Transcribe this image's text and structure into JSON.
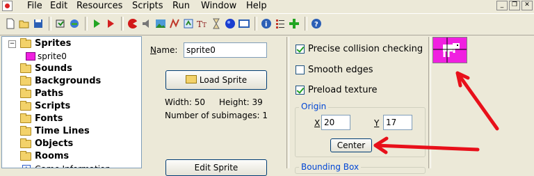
{
  "menubar": {
    "items": [
      "File",
      "Edit",
      "Resources",
      "Scripts",
      "Run",
      "Window",
      "Help"
    ]
  },
  "toolbar": {
    "icons": [
      "new-icon",
      "open-icon",
      "save-icon",
      "create-executable-icon",
      "publish-icon",
      "run-icon",
      "run-debug-icon",
      "add-sprite-icon",
      "add-sound-icon",
      "add-background-icon",
      "add-path-icon",
      "add-script-icon",
      "add-font-icon",
      "add-timeline-icon",
      "add-object-icon",
      "add-room-icon",
      "game-info-icon",
      "global-settings-icon",
      "extension-packages-icon",
      "help-icon"
    ]
  },
  "tree": {
    "items": [
      {
        "label": "Sprites",
        "expanded": true
      },
      {
        "label": "sprite0",
        "child": true
      },
      {
        "label": "Sounds"
      },
      {
        "label": "Backgrounds"
      },
      {
        "label": "Paths"
      },
      {
        "label": "Scripts"
      },
      {
        "label": "Fonts"
      },
      {
        "label": "Time Lines"
      },
      {
        "label": "Objects"
      },
      {
        "label": "Rooms"
      },
      {
        "label": "Game Information"
      }
    ]
  },
  "sprite": {
    "name_label": "Name:",
    "name_value": "sprite0",
    "load_button": "Load Sprite",
    "width_text": "Width: 50",
    "height_text": "Height: 39",
    "subimages_text": "Number of subimages: 1",
    "edit_button": "Edit Sprite",
    "precise_collision": {
      "label": "Precise collision checking",
      "checked": true
    },
    "smooth_edges": {
      "label": "Smooth edges",
      "checked": false
    },
    "preload_texture": {
      "label": "Preload texture",
      "checked": true
    },
    "origin": {
      "title": "Origin",
      "x_label": "X",
      "x_value": "20",
      "y_label": "Y",
      "y_value": "17",
      "center_button": "Center"
    },
    "bounding_box_title": "Bounding Box"
  },
  "colors": {
    "sprite_fill": "#f020e0",
    "annotation_arrow": "#e8101a",
    "group_title": "#0046d5"
  }
}
